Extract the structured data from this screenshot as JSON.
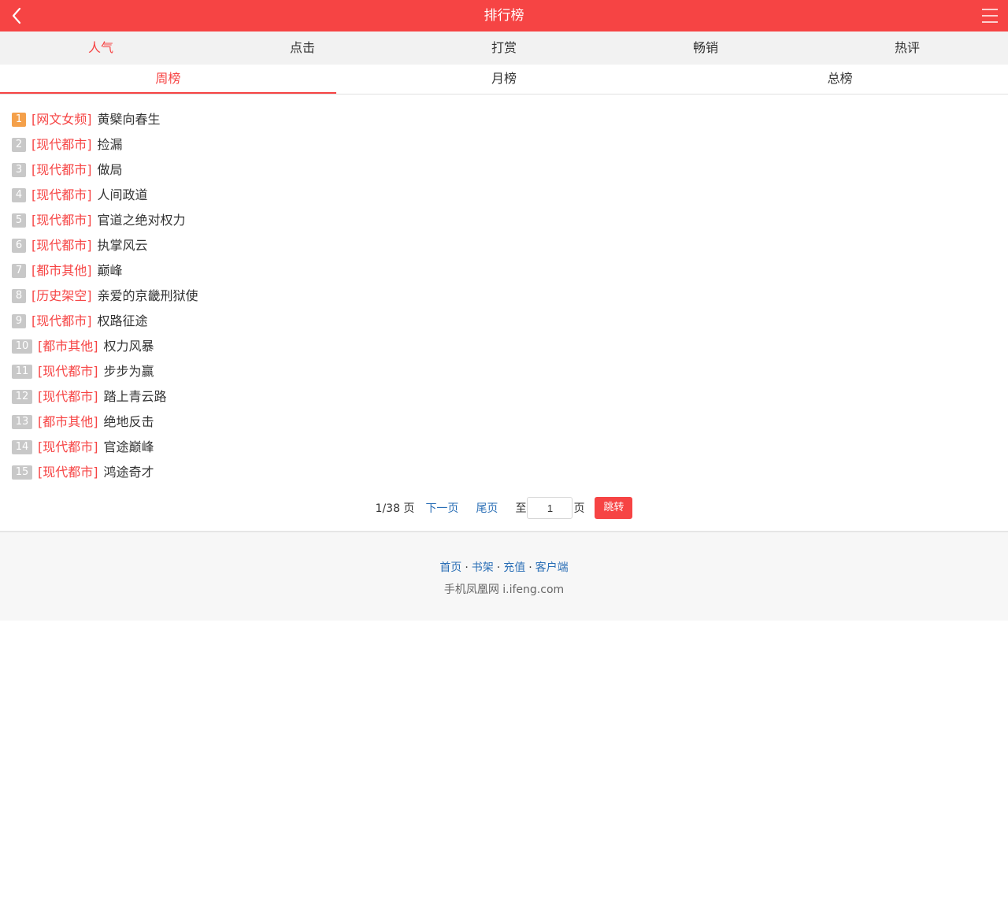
{
  "header": {
    "title": "排行榜",
    "back_icon": "chevron-left-icon",
    "menu_icon": "hamburger-menu-icon"
  },
  "colors": {
    "accent": "#f64444",
    "link": "#2b6fb6",
    "rank_first": "#f4a04a",
    "rank_other": "#c8c8c8"
  },
  "main_tabs": [
    {
      "label": "人气",
      "active": true
    },
    {
      "label": "点击",
      "active": false
    },
    {
      "label": "打赏",
      "active": false
    },
    {
      "label": "畅销",
      "active": false
    },
    {
      "label": "热评",
      "active": false
    }
  ],
  "period_tabs": [
    {
      "label": "周榜",
      "active": true
    },
    {
      "label": "月榜",
      "active": false
    },
    {
      "label": "总榜",
      "active": false
    }
  ],
  "ranking": [
    {
      "rank": "1",
      "category": "[网文女频]",
      "title": "黄檗向春生"
    },
    {
      "rank": "2",
      "category": "[现代都市]",
      "title": "捡漏"
    },
    {
      "rank": "3",
      "category": "[现代都市]",
      "title": "做局"
    },
    {
      "rank": "4",
      "category": "[现代都市]",
      "title": "人间政道"
    },
    {
      "rank": "5",
      "category": "[现代都市]",
      "title": "官道之绝对权力"
    },
    {
      "rank": "6",
      "category": "[现代都市]",
      "title": "执掌风云"
    },
    {
      "rank": "7",
      "category": "[都市其他]",
      "title": "巅峰"
    },
    {
      "rank": "8",
      "category": "[历史架空]",
      "title": "亲爱的京畿刑狱使"
    },
    {
      "rank": "9",
      "category": "[现代都市]",
      "title": "权路征途"
    },
    {
      "rank": "10",
      "category": "[都市其他]",
      "title": "权力风暴"
    },
    {
      "rank": "11",
      "category": "[现代都市]",
      "title": "步步为赢"
    },
    {
      "rank": "12",
      "category": "[现代都市]",
      "title": "踏上青云路"
    },
    {
      "rank": "13",
      "category": "[都市其他]",
      "title": "绝地反击"
    },
    {
      "rank": "14",
      "category": "[现代都市]",
      "title": "官途巅峰"
    },
    {
      "rank": "15",
      "category": "[现代都市]",
      "title": "鸿途奇才"
    }
  ],
  "pager": {
    "page_info": "1/38 页",
    "next_label": "下一页",
    "last_label": "尾页",
    "to_label": "至",
    "page_value": "1",
    "page_suffix": "页",
    "go_label": "跳转"
  },
  "footer": {
    "links": [
      "首页",
      "书架",
      "充值",
      "客户端"
    ],
    "separator": "·",
    "site": "手机凤凰网 i.ifeng.com"
  }
}
